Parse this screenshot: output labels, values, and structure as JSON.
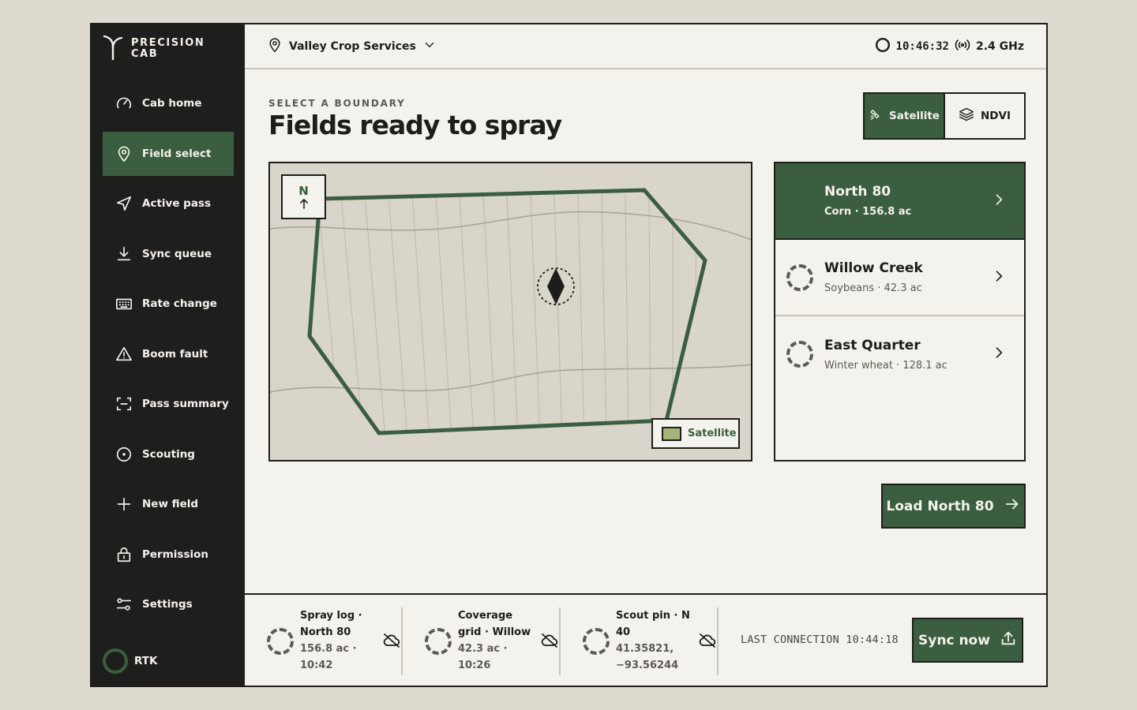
{
  "app": {
    "brand_line1": "PRECISION",
    "brand_line2": "CAB",
    "logo_icon": "sprout-logo-icon"
  },
  "sidebar": {
    "items": [
      {
        "label": "Cab home",
        "icon": "gauge-icon"
      },
      {
        "label": "Field select",
        "icon": "map-pin-icon",
        "active": true
      },
      {
        "label": "Active pass",
        "icon": "navigation-arrow-icon"
      },
      {
        "label": "Sync queue",
        "icon": "download-icon"
      },
      {
        "label": "Rate change",
        "icon": "keyboard-icon"
      },
      {
        "label": "Boom fault",
        "icon": "warning-triangle-icon"
      },
      {
        "label": "Pass summary",
        "icon": "scan-frame-icon"
      },
      {
        "label": "Scouting",
        "icon": "target-dot-icon"
      },
      {
        "label": "New field",
        "icon": "plus-icon"
      },
      {
        "label": "Permission",
        "icon": "lock-icon"
      },
      {
        "label": "Settings",
        "icon": "sliders-icon"
      }
    ],
    "rtk_label": "RTK"
  },
  "header": {
    "org_name": "Valley Crop Services",
    "clock": "10:46:32",
    "signal_label": "2.4 GHz"
  },
  "main": {
    "eyebrow": "SELECT A BOUNDARY",
    "title": "Fields ready to spray",
    "view_toggle": {
      "satellite": "Satellite",
      "ndvi": "NDVI",
      "selected": "Satellite"
    },
    "map": {
      "compass_label": "N",
      "legend_label": "Satellite"
    },
    "fields": [
      {
        "name": "North 80",
        "sub": "Corn · 156.8 ac",
        "selected": true
      },
      {
        "name": "Willow Creek",
        "sub": "Soybeans · 42.3 ac"
      },
      {
        "name": "East Quarter",
        "sub": "Winter wheat · 128.1 ac"
      }
    ],
    "load_button": "Load North 80"
  },
  "queue": {
    "items": [
      {
        "title": "Spray log · North 80",
        "meta": "156.8 ac · 10:42"
      },
      {
        "title": "Coverage grid · Willow",
        "meta": "42.3 ac · 10:26"
      },
      {
        "title": "Scout pin · N 40",
        "meta": "41.35821, −93.56244"
      }
    ],
    "last_connection": "LAST CONNECTION 10:44:18",
    "sync_button": "Sync now"
  },
  "colors": {
    "accent": "#3a5e3f",
    "sidebar_bg": "#1e1e1c",
    "page_bg": "#f4f2ec",
    "outer_bg": "#dedad0",
    "satellite_swatch": "#a3b678"
  }
}
